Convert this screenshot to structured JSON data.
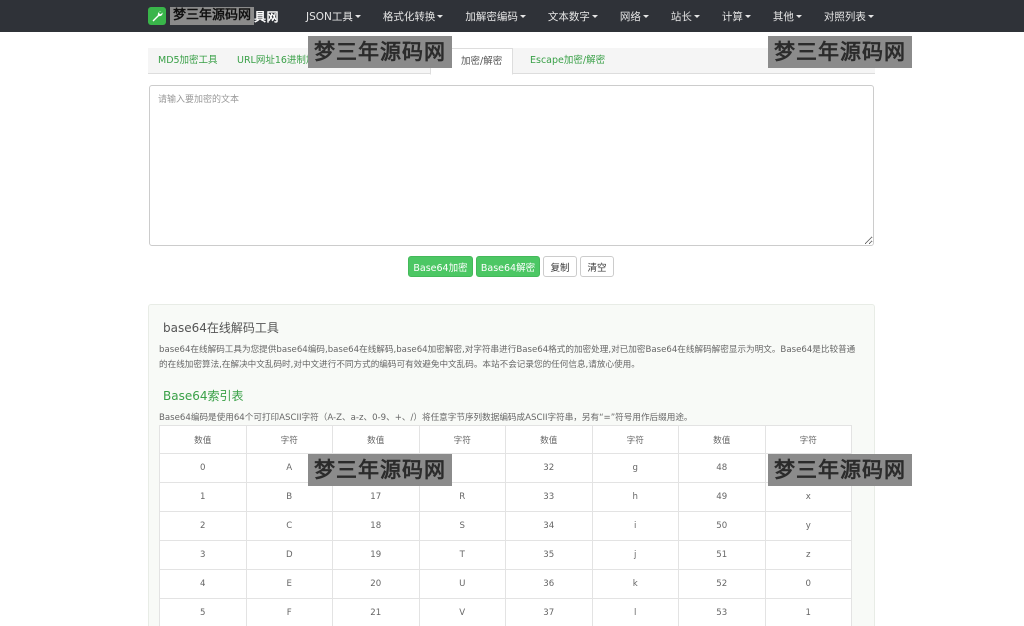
{
  "navbar": {
    "brand": "具网",
    "items": [
      {
        "label": "JSON工具"
      },
      {
        "label": "格式化转换"
      },
      {
        "label": "加解密编码"
      },
      {
        "label": "文本数字"
      },
      {
        "label": "网络"
      },
      {
        "label": "站长"
      },
      {
        "label": "计算"
      },
      {
        "label": "其他"
      },
      {
        "label": "对照列表"
      }
    ]
  },
  "tabs": [
    {
      "label": "MD5加密工具"
    },
    {
      "label": "URL网址16进制加"
    },
    {
      "label": "加密/解密"
    },
    {
      "label": "Escape加密/解密"
    }
  ],
  "input": {
    "placeholder": "请输入要加密的文本",
    "value": ""
  },
  "buttons": {
    "encode": "Base64加密",
    "decode": "Base64解密",
    "copy": "复制",
    "clear": "清空"
  },
  "info": {
    "title": "base64在线解码工具",
    "description": "base64在线解码工具为您提供base64编码,base64在线解码,base64加密解密,对字符串进行Base64格式的加密处理,对已加密Base64在线解码解密显示为明文。Base64是比较普通的在线加密算法,在解决中文乱码时,对中文进行不同方式的编码可有效避免中文乱码。本站不会记录您的任何信息,请放心使用。",
    "index_title": "Base64索引表",
    "index_desc": "Base64编码是使用64个可打印ASCII字符（A-Z、a-z、0-9、+、/）将任意字节序列数据编码成ASCII字符串，另有“=”符号用作后缀用途。"
  },
  "table": {
    "headers": [
      "数值",
      "字符",
      "数值",
      "字符",
      "数值",
      "字符",
      "数值",
      "字符"
    ],
    "rows": [
      [
        "0",
        "A",
        "",
        "",
        "32",
        "g",
        "48",
        ""
      ],
      [
        "1",
        "B",
        "17",
        "R",
        "33",
        "h",
        "49",
        "x"
      ],
      [
        "2",
        "C",
        "18",
        "S",
        "34",
        "i",
        "50",
        "y"
      ],
      [
        "3",
        "D",
        "19",
        "T",
        "35",
        "j",
        "51",
        "z"
      ],
      [
        "4",
        "E",
        "20",
        "U",
        "36",
        "k",
        "52",
        "0"
      ],
      [
        "5",
        "F",
        "21",
        "V",
        "37",
        "l",
        "53",
        "1"
      ]
    ]
  },
  "watermarks": {
    "text": "梦三年源码网",
    "small": "梦三年源码网"
  },
  "colors": {
    "navbar_bg": "#2f3238",
    "accent_green": "#4cc764",
    "link_green": "#39a047"
  },
  "icons": {
    "brand": "wrench-icon",
    "caret": "caret-down-icon"
  }
}
